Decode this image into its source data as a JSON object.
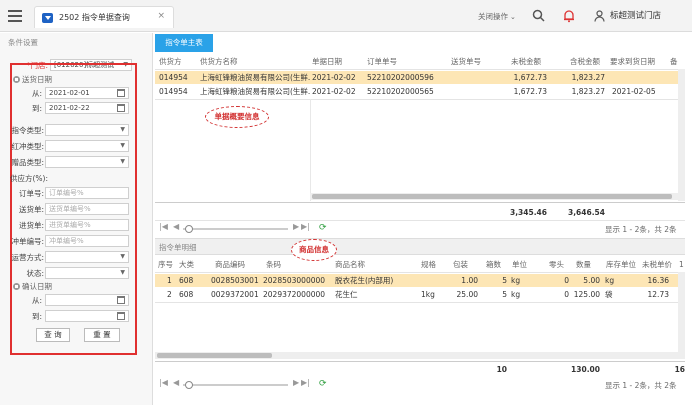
{
  "topbar": {
    "tab_title": "2502 指令单据查询",
    "tab_close": "×",
    "close_op": "关闭操作",
    "close_op_chevron": "⌄",
    "store": "标超测试门店"
  },
  "left": {
    "title": "条件设置",
    "store_label": "*门店:",
    "store_value": "[012620]标超测试",
    "section_date": "送货日期",
    "from_label": "从:",
    "from_value": "2021-02-01",
    "to_label": "到:",
    "to_value": "2021-02-22",
    "order_type_label": "指令类型:",
    "red_type_label": "红冲类型:",
    "gift_type_label": "赠品类型:",
    "supplier_label": "供应方(%):",
    "order_no_label": "订单号:",
    "order_no_ph": "订单编号%",
    "delivery_no_label": "送货单:",
    "delivery_no_ph": "送货单编号%",
    "receipt_no_label": "进货单:",
    "receipt_no_ph": "进货单编号%",
    "red_no_label": "冲单编号:",
    "red_no_ph": "冲单编号%",
    "ship_label": "运营方式:",
    "status_label": "状态:",
    "section_confirm": "确认日期",
    "c_from_label": "从:",
    "c_to_label": "到:",
    "query_btn": "查 询",
    "reset_btn": "重 置"
  },
  "main": {
    "tab_label": "指令单主表",
    "headers": [
      "供货方",
      "供货方名称",
      "单据日期",
      "订单单号",
      "送货单号",
      "未税金额",
      "含税金额",
      "要求到货日期",
      "备"
    ],
    "rows": [
      {
        "supplier": "014954",
        "name": "上海虹锋粮油贸易有限公司(生鲜...",
        "date": "2021-02-02",
        "order": "52210202000596",
        "delivery": "",
        "net": "1,672.73",
        "gross": "1,823.27",
        "req_date": ""
      },
      {
        "supplier": "014954",
        "name": "上海虹锋粮油贸易有限公司(生鲜...",
        "date": "2021-02-02",
        "order": "52210202000565",
        "delivery": "",
        "net": "1,672.73",
        "gross": "1,823.27",
        "req_date": "2021-02-05"
      }
    ],
    "total_net": "3,345.46",
    "total_gross": "3,646.54",
    "anno_top": "单据概要信息",
    "pager_info": "显示 1 - 2条，共 2条"
  },
  "detail": {
    "title": "指令单明细",
    "anno": "商品信息",
    "headers": [
      "序号",
      "大类",
      "商品编码",
      "条码",
      "商品名称",
      "规格",
      "包装",
      "箱数",
      "单位",
      "零头",
      "数量",
      "库存单位",
      "未税单价",
      "1"
    ],
    "rows": [
      {
        "seq": "1",
        "cat": "608",
        "code": "0028503001",
        "barcode": "2028503000000",
        "name": "脱衣花生(内部用)",
        "spec": "",
        "pack": "1.00",
        "boxes": "5",
        "unit": "kg",
        "odd": "0",
        "qty": "5.00",
        "stock_unit": "kg",
        "price": "16.36"
      },
      {
        "seq": "2",
        "cat": "608",
        "code": "0029372001",
        "barcode": "2029372000000",
        "name": "花生仁",
        "spec": "1kg",
        "pack": "25.00",
        "boxes": "5",
        "unit": "kg",
        "odd": "0",
        "qty": "125.00",
        "stock_unit": "袋",
        "price": "12.73"
      }
    ],
    "total_boxes": "10",
    "total_qty": "130.00",
    "total_tail": "16",
    "pager_info": "显示 1 - 2条，共 2条"
  },
  "colors": {
    "accent": "#2aa2e8",
    "selected_row": "#fde6b5",
    "annotation": "#d23030"
  }
}
